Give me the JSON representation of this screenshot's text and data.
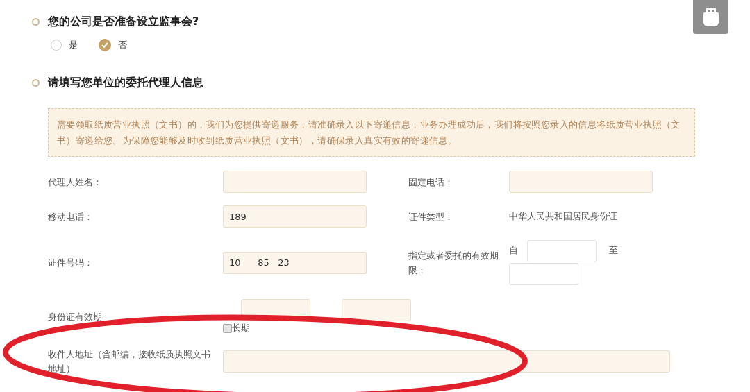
{
  "sections": [
    {
      "title": "您的公司是否准备设立监事会?",
      "options": [
        {
          "label": "是",
          "selected": false
        },
        {
          "label": "否",
          "selected": true
        }
      ]
    },
    {
      "title": "请填写您单位的委托代理人信息"
    }
  ],
  "notice": "需要领取纸质营业执照（文书）的，我们为您提供寄递服务，请准确录入以下寄递信息，业务办理成功后，我们将按照您录入的信息将纸质营业执照（文书）寄递给您。为保障您能够及时收到纸质营业执照（文书），请确保录入真实有效的寄递信息。",
  "rows": [
    [
      {
        "kind": "input",
        "label": "代理人姓名："
      },
      {
        "kind": "input",
        "label": "固定电话："
      }
    ],
    [
      {
        "kind": "input",
        "label": "移动电话：",
        "value": "189"
      },
      {
        "kind": "text",
        "label": "证件类型：",
        "value": "中华人民共和国居民身份证"
      }
    ],
    [
      {
        "kind": "input",
        "label": "证件号码：",
        "value": "10      85   23"
      },
      {
        "kind": "range",
        "label": "指定或者委托的有效期限：",
        "from_label": "自",
        "to_label": "至"
      }
    ],
    [
      {
        "kind": "range_check",
        "label": "身份证有效期",
        "check": {
          "label": "长期",
          "checked": false
        }
      }
    ],
    [
      {
        "kind": "wide_input",
        "label": "收件人地址（含邮编，接收纸质执照文书地址）"
      }
    ]
  ]
}
